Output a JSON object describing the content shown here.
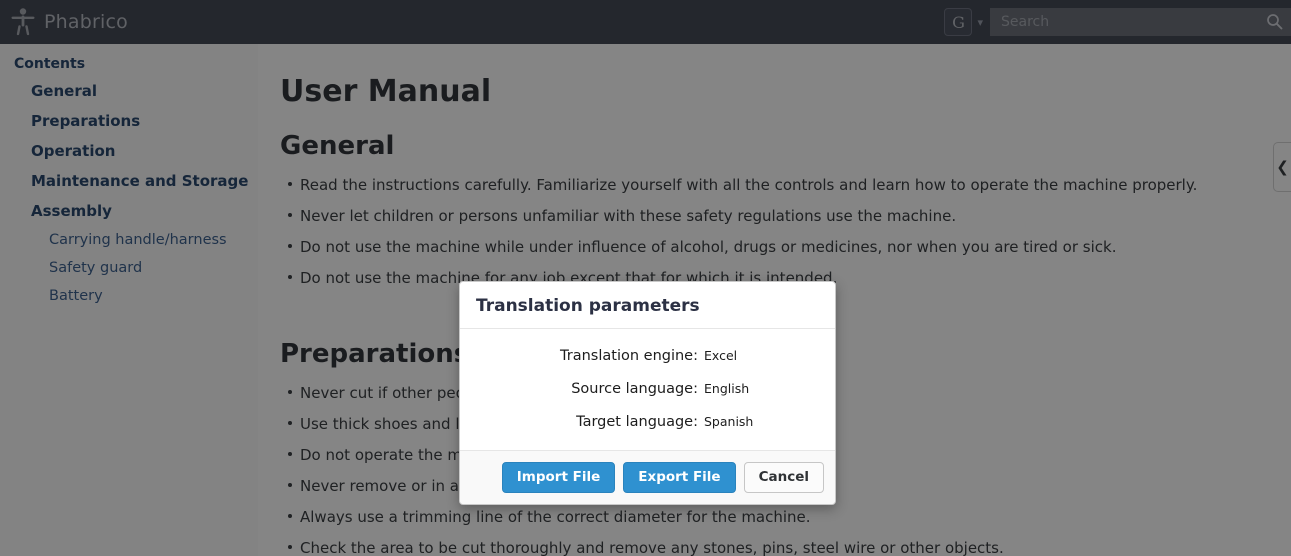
{
  "header": {
    "brand": "Phabrico",
    "brand_icon": "person-accessibility-icon",
    "user_badge": "G",
    "user_chevron_icon": "chevron-down-icon",
    "search": {
      "value": "",
      "placeholder": "Search",
      "icon": "search-icon"
    },
    "background_color": "#464b57"
  },
  "sidebar": {
    "root_label": "Contents",
    "items": [
      {
        "label": "General",
        "level": 1
      },
      {
        "label": "Preparations",
        "level": 1
      },
      {
        "label": "Operation",
        "level": 1
      },
      {
        "label": "Maintenance and Storage",
        "level": 1
      },
      {
        "label": "Assembly",
        "level": 1
      },
      {
        "label": "Carrying handle/harness",
        "level": 2
      },
      {
        "label": "Safety guard",
        "level": 2
      },
      {
        "label": "Battery",
        "level": 2
      }
    ],
    "link_color": "#2b4a6f"
  },
  "content": {
    "title": "User Manual",
    "sections": [
      {
        "heading": "General",
        "bullets": [
          "Read the instructions carefully. Familiarize yourself with all the controls and learn how to operate the machine properly.",
          "Never let children or persons unfamiliar with these safety regulations use the machine.",
          "Do not use the machine while under influence of alcohol, drugs or medicines, nor when you are tired or sick.",
          "Do not use the machine for any job except that for which it is intended."
        ]
      },
      {
        "heading": "Preparations",
        "bullets": [
          "Never cut if other people, especially children or animals, are nearby.",
          "Use thick shoes and long trousers while operating the machine.",
          "Do not operate the machine when barefoot or wearing open sandals.",
          "Never remove or in any way modify the safety devices of the machine.",
          "Always use a trimming line of the correct diameter for the machine.",
          "Check the area to be cut thoroughly and remove any stones, pins, steel wire or other objects."
        ]
      }
    ]
  },
  "collapse_tab": {
    "icon": "chevron-left-icon"
  },
  "modal": {
    "title": "Translation parameters",
    "fields": [
      {
        "label": "Translation engine:",
        "value": "Excel"
      },
      {
        "label": "Source language:",
        "value": "English"
      },
      {
        "label": "Target language:",
        "value": "Spanish"
      }
    ],
    "buttons": [
      {
        "label": "Import File",
        "style": "primary"
      },
      {
        "label": "Export File",
        "style": "primary"
      },
      {
        "label": "Cancel",
        "style": "default"
      }
    ],
    "primary_color": "#2f91d0"
  }
}
